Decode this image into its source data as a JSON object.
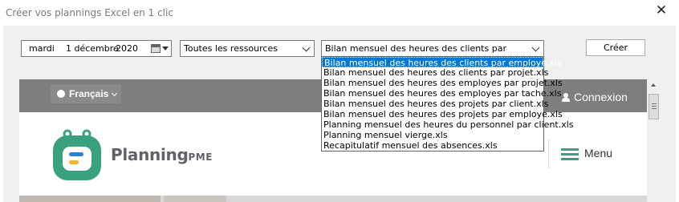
{
  "window": {
    "title": "Créer vos plannings Excel en 1 clic",
    "close_glyph": "✕"
  },
  "date": {
    "weekday": "mardi",
    "day_month": "1 décembre",
    "year": "2020"
  },
  "resources": {
    "selected": "Toutes les ressources"
  },
  "report": {
    "selected": "Bilan mensuel des heures des clients par employe.xls",
    "options": [
      "Bilan mensuel des heures des clients par employe.xls",
      "Bilan mensuel des heures des clients par projet.xls",
      "Bilan mensuel des heures des employes par projet.xls",
      "Bilan mensuel des heures des employes par tache.xls",
      "Bilan mensuel des heures des projets par client.xls",
      "Bilan mensuel des heures des projets par employe.xls",
      "Planning mensuel des heures du personnel par client.xls",
      "Planning mensuel vierge.xls",
      "Recapitulatif mensuel des absences.xls"
    ],
    "highlighted_index": 0
  },
  "create_button": "Créer",
  "webpage": {
    "language": "Français",
    "login": "Connexion",
    "brand_main": "Planning",
    "brand_suffix": "PME",
    "menu": "Menu",
    "colors": {
      "topbar": "#7e7e7e",
      "accent": "#3aa17e",
      "logo_blue": "#2d7fd4",
      "logo_yellow": "#f2b632"
    }
  },
  "colors": {
    "selection": "#0078d7"
  }
}
